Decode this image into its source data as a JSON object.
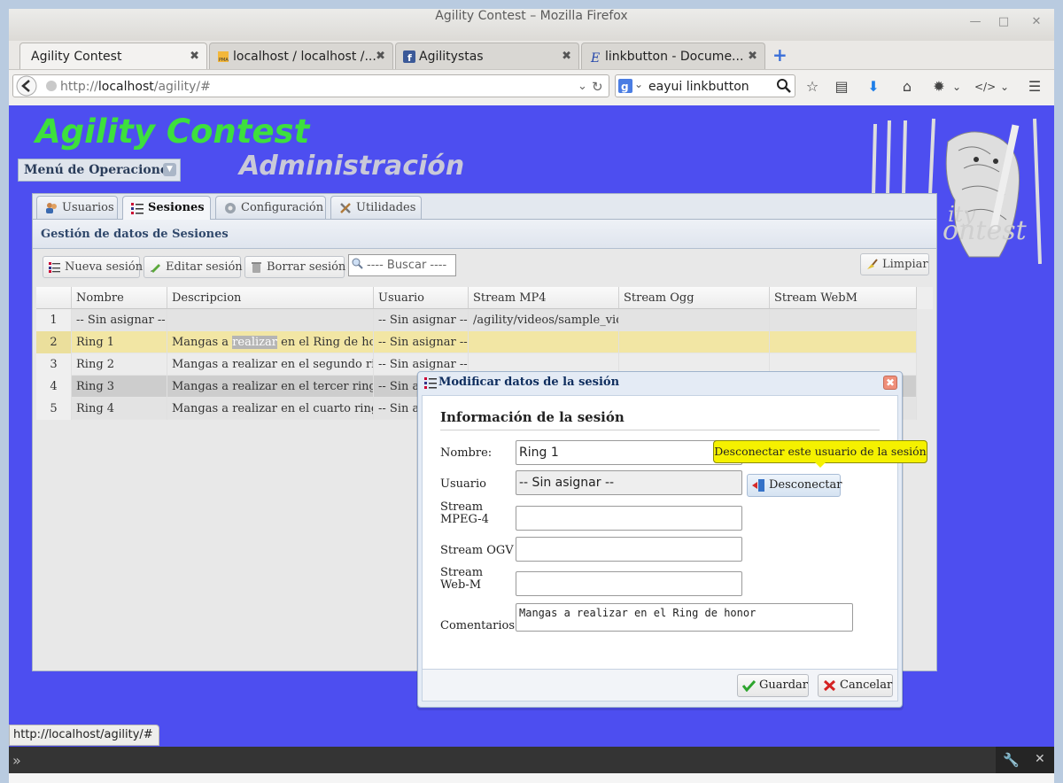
{
  "window": {
    "title": "Agility Contest – Mozilla Firefox"
  },
  "tabs": [
    {
      "label": "Agility Contest",
      "active": true
    },
    {
      "label": "localhost / localhost /...",
      "active": false
    },
    {
      "label": "Agilitystas",
      "active": false
    },
    {
      "label": "linkbutton - Docume...",
      "active": false
    }
  ],
  "navbar": {
    "url_prefix": "http://",
    "url_host": "localhost",
    "url_path": "/agility/#",
    "search_value": "eayui linkbutton"
  },
  "page": {
    "app_title": "Agility Contest",
    "admin_title": "Administración",
    "menu_label": "Menú de Operaciones"
  },
  "panel": {
    "tabs": [
      {
        "label": "Usuarios"
      },
      {
        "label": "Sesiones",
        "active": true
      },
      {
        "label": "Configuración"
      },
      {
        "label": "Utilidades"
      }
    ],
    "section_title": "Gestión de datos de Sesiones",
    "toolbar": {
      "new_label": "Nueva sesión",
      "edit_label": "Editar sesión",
      "delete_label": "Borrar sesión",
      "search_placeholder": "---- Buscar ----",
      "clear_label": "Limpiar"
    },
    "columns": [
      "",
      "Nombre",
      "Descripcion",
      "Usuario",
      "Stream MP4",
      "Stream Ogg",
      "Stream WebM"
    ],
    "rows": [
      {
        "num": "1",
        "nombre": "-- Sin asignar --",
        "descripcion": "",
        "usuario": "-- Sin asignar --",
        "mp4": "/agility/videos/sample_vide",
        "ogg": "",
        "webm": ""
      },
      {
        "num": "2",
        "nombre": "Ring 1",
        "desc_a": "Mangas a ",
        "desc_hl": "realizar",
        "desc_b": " en el Ring de honc",
        "usuario": "-- Sin asignar --",
        "mp4": "",
        "ogg": "",
        "webm": ""
      },
      {
        "num": "3",
        "nombre": "Ring 2",
        "descripcion": "Mangas a realizar en el segundo ring",
        "usuario": "-- Sin asignar --",
        "mp4": "",
        "ogg": "",
        "webm": ""
      },
      {
        "num": "4",
        "nombre": "Ring 3",
        "descripcion": "Mangas a realizar en el tercer ring",
        "usuario": "-- Sin a",
        "mp4": "",
        "ogg": "",
        "webm": ""
      },
      {
        "num": "5",
        "nombre": "Ring 4",
        "descripcion": "Mangas a realizar en el cuarto ring",
        "usuario": "-- Sin a",
        "mp4": "",
        "ogg": "",
        "webm": ""
      }
    ]
  },
  "dialog": {
    "title": "Modificar datos de la sesión",
    "legend": "Información de la sesión",
    "labels": {
      "nombre": "Nombre:",
      "usuario": "Usuario",
      "mpeg4": "Stream MPEG-4",
      "ogv": "Stream OGV",
      "webm": "Stream Web-M",
      "comentarios": "Comentarios"
    },
    "values": {
      "nombre": "Ring 1",
      "usuario": "-- Sin asignar --",
      "mpeg4": "",
      "ogv": "",
      "webm": "",
      "comentarios": "Mangas a realizar en el Ring de honor"
    },
    "disconnect_label": "Desconectar",
    "tooltip": "Desconectar este usuario de la sesión",
    "save_label": "Guardar",
    "cancel_label": "Cancelar"
  },
  "statusbar": {
    "text": "http://localhost/agility/#"
  },
  "colors": {
    "page_bg": "#4d4ef0",
    "app_title": "#3de03d",
    "selected_row": "#f2e6a4",
    "tooltip": "#f5f100"
  }
}
